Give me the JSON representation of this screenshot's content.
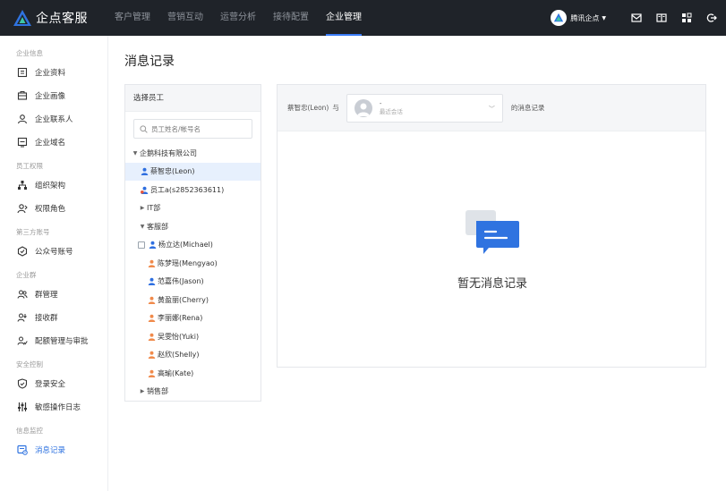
{
  "app": {
    "name": "企点客服",
    "colors": {
      "topbar": "#1f2329",
      "accent": "#2f73e0",
      "selected_bg": "#e7f0fd"
    }
  },
  "topnav": {
    "tabs": [
      {
        "label": "客户管理",
        "active": false
      },
      {
        "label": "营销互动",
        "active": false
      },
      {
        "label": "运营分析",
        "active": false
      },
      {
        "label": "接待配置",
        "active": false
      },
      {
        "label": "企业管理",
        "active": true
      }
    ],
    "tenant": "腾讯企点",
    "icons": [
      "mail-icon",
      "book-icon",
      "grid-icon",
      "logout-icon"
    ]
  },
  "sidebar": {
    "groups": [
      {
        "title": "企业信息",
        "items": [
          {
            "label": "企业资料",
            "icon": "profile-icon"
          },
          {
            "label": "企业画像",
            "icon": "portrait-icon"
          },
          {
            "label": "企业联系人",
            "icon": "contact-icon"
          },
          {
            "label": "企业域名",
            "icon": "domain-icon"
          }
        ]
      },
      {
        "title": "员工权限",
        "items": [
          {
            "label": "组织架构",
            "icon": "org-icon"
          },
          {
            "label": "权限角色",
            "icon": "role-icon"
          }
        ]
      },
      {
        "title": "第三方账号",
        "items": [
          {
            "label": "公众号账号",
            "icon": "official-account-icon"
          }
        ]
      },
      {
        "title": "企业群",
        "items": [
          {
            "label": "群管理",
            "icon": "group-icon"
          },
          {
            "label": "接收群",
            "icon": "receive-group-icon"
          },
          {
            "label": "配额管理与审批",
            "icon": "quota-icon"
          }
        ]
      },
      {
        "title": "安全控制",
        "items": [
          {
            "label": "登录安全",
            "icon": "shield-icon"
          },
          {
            "label": "敏感操作日志",
            "icon": "sliders-icon"
          }
        ]
      },
      {
        "title": "信息监控",
        "items": [
          {
            "label": "消息记录",
            "icon": "message-record-icon",
            "active": true
          }
        ]
      }
    ]
  },
  "main": {
    "title": "消息记录",
    "employee_panel": {
      "header": "选择员工",
      "search_placeholder": "员工姓名/帐号名",
      "tree": [
        {
          "label": "企鹅科技有限公司",
          "type": "dept",
          "expanded": true,
          "indent": 0
        },
        {
          "label": "蔡智忠(Leon)",
          "type": "user-blue",
          "indent": 1,
          "selected": true
        },
        {
          "label": "员工a(s2852363611)",
          "type": "user-admin",
          "indent": 1
        },
        {
          "label": "IT部",
          "type": "dept",
          "expanded": false,
          "indent": 1
        },
        {
          "label": "客服部",
          "type": "dept",
          "expanded": true,
          "indent": 1
        },
        {
          "label": "杨立达(Michael)",
          "type": "user-blue-box",
          "indent": 2
        },
        {
          "label": "陈梦瑶(Mengyao)",
          "type": "user-orange",
          "indent": 3
        },
        {
          "label": "范嘉伟(Jason)",
          "type": "user-blue",
          "indent": 3
        },
        {
          "label": "黄盈丽(Cherry)",
          "type": "user-orange",
          "indent": 3
        },
        {
          "label": "李丽娜(Rena)",
          "type": "user-orange",
          "indent": 3
        },
        {
          "label": "吴雯怡(Yuki)",
          "type": "user-orange",
          "indent": 3
        },
        {
          "label": "赵欣(Shelly)",
          "type": "user-orange",
          "indent": 3
        },
        {
          "label": "高瑜(Kate)",
          "type": "user-orange",
          "indent": 3
        },
        {
          "label": "销售部",
          "type": "dept",
          "expanded": false,
          "indent": 1
        }
      ]
    },
    "record_panel": {
      "subject": "蔡智忠(Leon)",
      "with": "与",
      "chat_name": "-",
      "chat_sub": "最近会话",
      "suffix": "的消息记录",
      "empty_text": "暂无消息记录"
    }
  }
}
